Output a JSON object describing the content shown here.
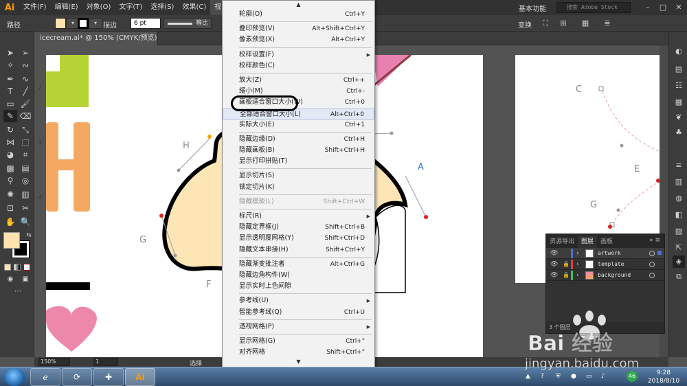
{
  "app": {
    "logo": "Ai"
  },
  "menubar": {
    "items": [
      "文件(F)",
      "编辑(E)",
      "对象(O)",
      "文字(T)",
      "选择(S)",
      "效果(C)",
      "视图(V)"
    ],
    "workspace": "基本功能",
    "search_placeholder": "搜索 Adobe Stock"
  },
  "controlbar": {
    "selection_label": "路径",
    "stroke_label": "描边",
    "stroke_weight": "6 pt",
    "stroke_profile": "等比",
    "transform_label": "变换"
  },
  "document": {
    "tab_title": "icecream.ai* @ 150% (CMYK/预览)"
  },
  "statusbar": {
    "zoom": "150%",
    "page": "1",
    "status": "选择"
  },
  "view_menu": {
    "items": [
      {
        "label": "轮廓(O)",
        "shortcut": "Ctrl+Y"
      },
      {
        "sep": true
      },
      {
        "label": "叠印预览(V)",
        "shortcut": "Alt+Shift+Ctrl+Y"
      },
      {
        "label": "像素预览(X)",
        "shortcut": "Alt+Ctrl+Y"
      },
      {
        "sep": true
      },
      {
        "label": "校样设置(F)",
        "submenu": true
      },
      {
        "label": "校样颜色(C)"
      },
      {
        "sep": true
      },
      {
        "label": "放大(Z)",
        "shortcut": "Ctrl++"
      },
      {
        "label": "缩小(M)",
        "shortcut": "Ctrl+-"
      },
      {
        "label": "画板适合窗口大小(W)",
        "shortcut": "Ctrl+0"
      },
      {
        "label": "全部适合窗口大小(L)",
        "shortcut": "Alt+Ctrl+0",
        "hover": true
      },
      {
        "label": "实际大小(E)",
        "shortcut": "Ctrl+1"
      },
      {
        "sep": true
      },
      {
        "label": "隐藏边缘(D)",
        "shortcut": "Ctrl+H"
      },
      {
        "label": "隐藏画板(B)",
        "shortcut": "Shift+Ctrl+H"
      },
      {
        "label": "显示打印拼贴(T)"
      },
      {
        "sep": true
      },
      {
        "label": "显示切片(S)"
      },
      {
        "label": "锁定切片(K)"
      },
      {
        "sep": true
      },
      {
        "label": "隐藏模板(L)",
        "shortcut": "Shift+Ctrl+W",
        "disabled": true
      },
      {
        "sep": true
      },
      {
        "label": "标尺(R)",
        "submenu": true
      },
      {
        "label": "隐藏定界框(J)",
        "shortcut": "Shift+Ctrl+B"
      },
      {
        "label": "显示透明度网格(Y)",
        "shortcut": "Shift+Ctrl+D"
      },
      {
        "label": "隐藏文本串接(H)",
        "shortcut": "Shift+Ctrl+Y"
      },
      {
        "sep": true
      },
      {
        "label": "隐藏渐变批注者",
        "shortcut": "Alt+Ctrl+G"
      },
      {
        "label": "隐藏边角构件(W)"
      },
      {
        "label": "显示实时上色间隙"
      },
      {
        "sep": true
      },
      {
        "label": "参考线(U)",
        "submenu": true
      },
      {
        "label": "智能参考线(Q)",
        "shortcut": "Ctrl+U"
      },
      {
        "sep": true
      },
      {
        "label": "透视网格(P)",
        "submenu": true
      },
      {
        "sep": true
      },
      {
        "label": "显示网格(G)",
        "shortcut": "Ctrl+\""
      },
      {
        "label": "对齐网格",
        "shortcut": "Shift+Ctrl+\""
      }
    ]
  },
  "canvas": {
    "ruler_marks": [
      "2",
      "3",
      "4"
    ],
    "anchor_labels": [
      "H",
      "A",
      "G",
      "F",
      "C",
      "E",
      "G"
    ]
  },
  "layers_panel": {
    "tabs": [
      "资源导出",
      "图层",
      "画板"
    ],
    "active_tab": "图层",
    "layers": [
      {
        "name": "artwork",
        "color": "#4a6fd6",
        "selected": true
      },
      {
        "name": "template",
        "color": "#e04040",
        "locked": true
      },
      {
        "name": "background",
        "color": "#3fbf5a",
        "locked": true
      }
    ],
    "footer": "3 个图层"
  },
  "taskbar": {
    "ai_label": "Ai",
    "badge": "46"
  },
  "clock": {
    "time": "9:28",
    "date": "2018/8/10"
  },
  "watermark": {
    "brand": "Bai 经验",
    "url": "jingyan.baidu.com"
  },
  "colors": {
    "fill": "#fde2b0",
    "accent": "#ff9a00"
  }
}
